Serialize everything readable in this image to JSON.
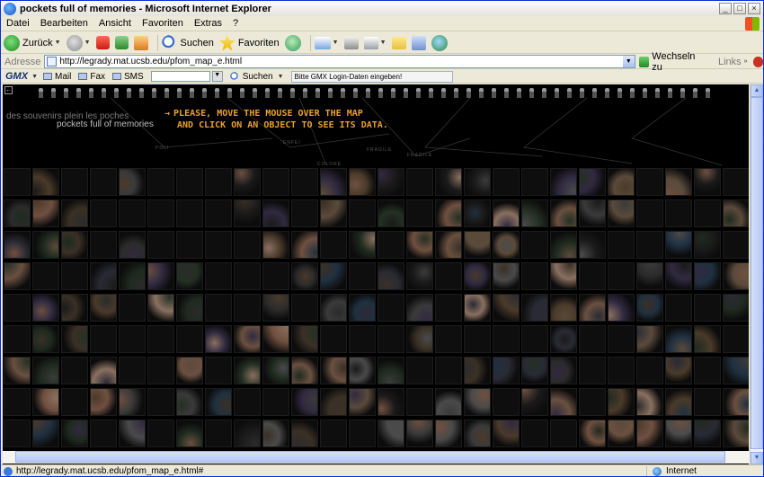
{
  "window": {
    "title": "pockets full of memories - Microsoft Internet Explorer",
    "minimize": "_",
    "maximize": "□",
    "close": "×"
  },
  "menu": [
    "Datei",
    "Bearbeiten",
    "Ansicht",
    "Favoriten",
    "Extras",
    "?"
  ],
  "toolbar": {
    "back": "Zurück",
    "search": "Suchen",
    "favorites": "Favoriten"
  },
  "address": {
    "label": "Adresse",
    "url": "http://legrady.mat.ucsb.edu/pfom_map_e.html",
    "go": "Wechseln zu",
    "links": "Links"
  },
  "gmx": {
    "brand": "GMX",
    "mail": "Mail",
    "fax": "Fax",
    "sms": "SMS",
    "search": "Suchen",
    "login": "Bitte GMX Login-Daten eingeben!"
  },
  "page": {
    "subtitle_fr": "des souvenirs plein les poches",
    "subtitle_en": "pockets full of memories",
    "instruction_1": "PLEASE, MOVE THE MOUSE OVER THE MAP",
    "instruction_2": "AND CLICK ON AN OBJECT TO SEE ITS DATA.",
    "categories": [
      "ENFEI",
      "COLORÉ",
      "FRAGILE",
      "FRAGILE",
      "POLI"
    ]
  },
  "status": {
    "url": "http://legrady.mat.ucsb.edu/pfom_map_e.html#",
    "zone": "Internet"
  },
  "colors": {
    "title_text": "#000000",
    "instruction": "#e8a030",
    "background": "#000000"
  }
}
